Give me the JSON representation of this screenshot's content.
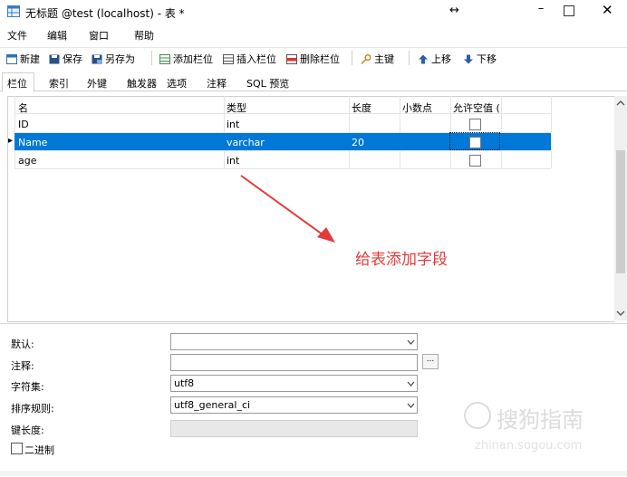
{
  "window": {
    "title": "无标题 @test (localhost) - 表 *",
    "resize_glyph": "↔",
    "minimize_glyph": "–",
    "close_glyph": "✕"
  },
  "menu": [
    "文件",
    "编辑",
    "窗口",
    "帮助"
  ],
  "toolbar": {
    "new": "新建",
    "save": "保存",
    "save_as": "另存为",
    "add_field": "添加栏位",
    "insert_field": "插入栏位",
    "delete_field": "删除栏位",
    "primary_key": "主键",
    "move_up": "上移",
    "move_down": "下移"
  },
  "tabs": [
    "栏位",
    "索引",
    "外键",
    "触发器",
    "选项",
    "注释",
    "SQL 预览"
  ],
  "grid": {
    "columns": [
      "名",
      "类型",
      "长度",
      "小数点",
      "允许空值 ("
    ],
    "rows": [
      {
        "name": "ID",
        "type": "int",
        "length": "",
        "decimals": "",
        "nullable": false
      },
      {
        "name": "Name",
        "type": "varchar",
        "length": "20",
        "decimals": "",
        "nullable": false,
        "selected": true
      },
      {
        "name": "age",
        "type": "int",
        "length": "",
        "decimals": "",
        "nullable": false
      }
    ],
    "row_marker": "▸"
  },
  "annotation": "给表添加字段",
  "properties": {
    "default_label": "默认:",
    "default_value": "",
    "comment_label": "注释:",
    "comment_value": "",
    "comment_btn": "...",
    "charset_label": "字符集:",
    "charset_value": "utf8",
    "collation_label": "排序规则:",
    "collation_value": "utf8_general_ci",
    "keylen_label": "键长度:",
    "binary_label": "二进制"
  },
  "watermark": {
    "text": "搜狗指南",
    "url": "zhinan.sogou.com"
  },
  "colors": {
    "selection": "#0078d7",
    "annotation": "#e53a3a"
  }
}
